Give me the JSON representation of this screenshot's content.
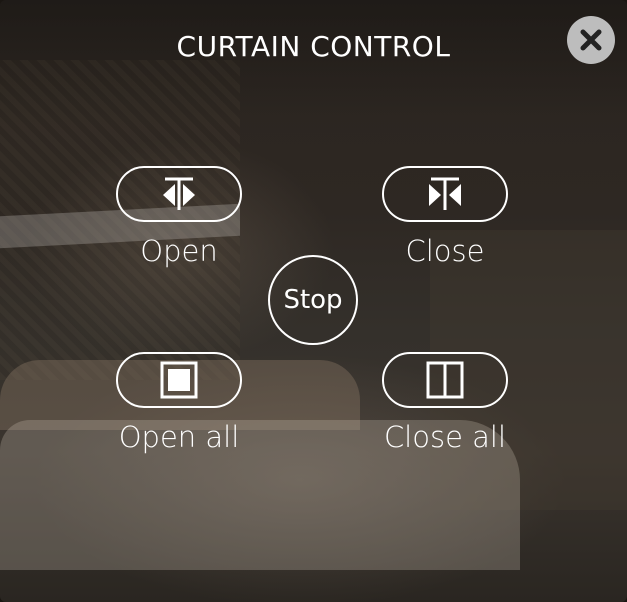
{
  "title": "CURTAIN CONTROL",
  "controls": {
    "open": {
      "label": "Open",
      "icon": "curtain-open-icon"
    },
    "close": {
      "label": "Close",
      "icon": "curtain-close-icon"
    },
    "stop": {
      "label": "Stop"
    },
    "open_all": {
      "label": "Open all",
      "icon": "curtain-open-all-icon"
    },
    "close_all": {
      "label": "Close all",
      "icon": "curtain-close-all-icon"
    }
  },
  "close_button": {
    "icon": "close-icon"
  },
  "colors": {
    "foreground": "#ffffff",
    "close_button_bg": "#bdbdbd",
    "close_button_fg": "#222222"
  }
}
